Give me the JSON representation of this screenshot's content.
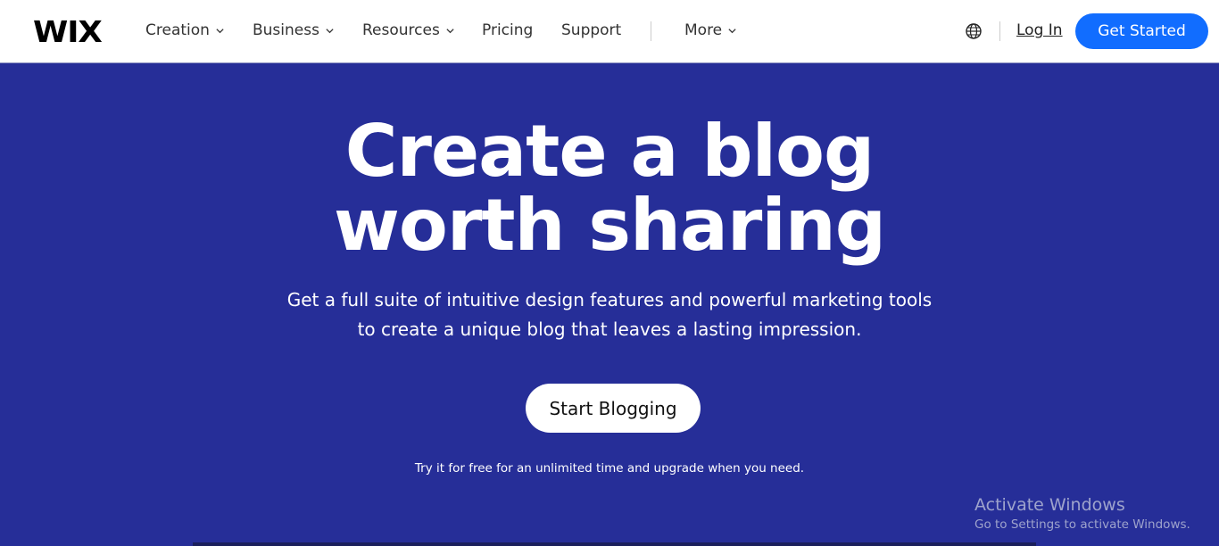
{
  "nav": {
    "logo": "WIX",
    "items": [
      {
        "label": "Creation",
        "has_dropdown": true
      },
      {
        "label": "Business",
        "has_dropdown": true
      },
      {
        "label": "Resources",
        "has_dropdown": true
      },
      {
        "label": "Pricing",
        "has_dropdown": false
      },
      {
        "label": "Support",
        "has_dropdown": false
      },
      {
        "label": "More",
        "has_dropdown": true
      }
    ],
    "language_icon": "globe-icon",
    "login_label": "Log In",
    "cta_label": "Get Started"
  },
  "hero": {
    "title_line1": "Create a blog",
    "title_line2": "worth sharing",
    "subtitle_line1": "Get a full suite of intuitive design features and powerful marketing tools",
    "subtitle_line2": "to create a unique blog that leaves a lasting impression.",
    "button_label": "Start Blogging",
    "note": "Try it for free for an unlimited time and upgrade when you need."
  },
  "watermark": {
    "title": "Activate Windows",
    "subtitle": "Go to Settings to activate Windows."
  },
  "colors": {
    "hero_bg": "#262e98",
    "cta_blue": "#116dff"
  }
}
